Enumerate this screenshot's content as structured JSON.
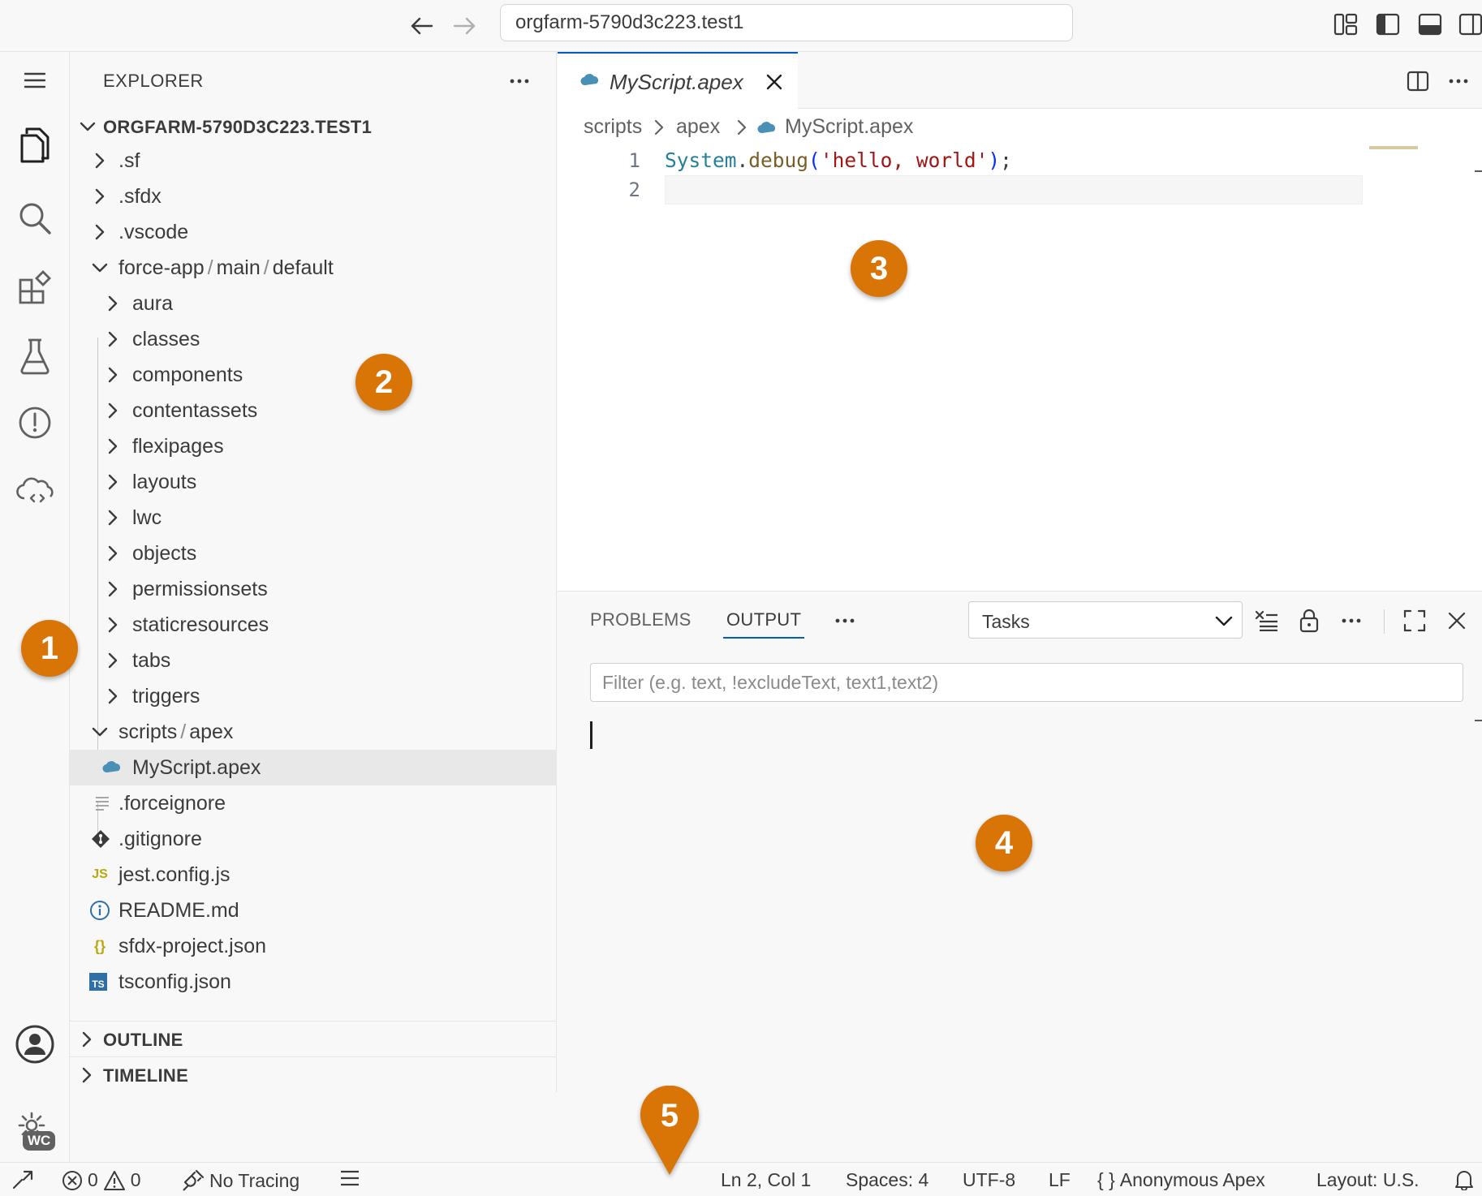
{
  "titlebar": {
    "search_text": "orgfarm-5790d3c223.test1"
  },
  "explorer": {
    "title": "EXPLORER",
    "root": "ORGFARM-5790D3C223.TEST1",
    "items": [
      {
        "label": ".sf"
      },
      {
        "label": ".sfdx"
      },
      {
        "label": ".vscode"
      },
      {
        "label_parts": [
          "force-app",
          "main",
          "default"
        ]
      },
      {
        "label": "aura"
      },
      {
        "label": "classes"
      },
      {
        "label": "components"
      },
      {
        "label": "contentassets"
      },
      {
        "label": "flexipages"
      },
      {
        "label": "layouts"
      },
      {
        "label": "lwc"
      },
      {
        "label": "objects"
      },
      {
        "label": "permissionsets"
      },
      {
        "label": "staticresources"
      },
      {
        "label": "tabs"
      },
      {
        "label": "triggers"
      },
      {
        "label_parts": [
          "scripts",
          "apex"
        ]
      },
      {
        "label": "MyScript.apex"
      },
      {
        "label": ".forceignore"
      },
      {
        "label": ".gitignore"
      },
      {
        "label": "jest.config.js",
        "icon_text": "JS"
      },
      {
        "label": "README.md"
      },
      {
        "label": "sfdx-project.json",
        "icon_text": "{}"
      },
      {
        "label": "tsconfig.json",
        "icon_text": "TS"
      }
    ],
    "sections": [
      "OUTLINE",
      "TIMELINE"
    ]
  },
  "editor": {
    "tab_label": "MyScript.apex",
    "breadcrumb": [
      "scripts",
      "apex",
      "MyScript.apex"
    ],
    "line_numbers": [
      "1",
      "2"
    ],
    "code": {
      "class": "System",
      "dot": ".",
      "method": "debug",
      "open_paren": "(",
      "string": "'hello, world'",
      "close_paren": ")",
      "semicolon": ";"
    }
  },
  "panel": {
    "tabs": [
      "PROBLEMS",
      "OUTPUT"
    ],
    "active_tab": "OUTPUT",
    "channel": "Tasks",
    "filter_placeholder": "Filter (e.g. text, !excludeText, text1,text2)"
  },
  "statusbar": {
    "errors": "0",
    "warnings": "0",
    "tracing": "No Tracing",
    "position": "Ln 2, Col 1",
    "spaces": "Spaces: 4",
    "encoding": "UTF-8",
    "eol": "LF",
    "language_icon": "{ }",
    "language": "Anonymous Apex",
    "layout": "Layout: U.S."
  },
  "account_badge": "WC",
  "callouts": [
    "1",
    "2",
    "3",
    "4",
    "5"
  ],
  "colors": {
    "accent": "#005fb8",
    "callout": "#d97406",
    "apex_icon": "#4a8fb5"
  }
}
